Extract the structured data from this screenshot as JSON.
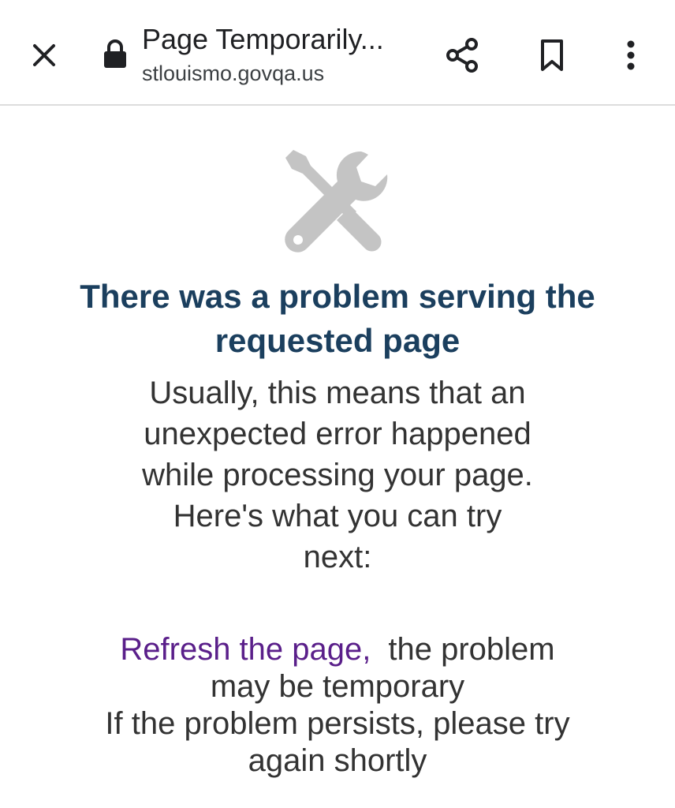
{
  "browser": {
    "page_title": "Page Temporarily...",
    "url": "stlouismo.govqa.us",
    "icons": {
      "close": "close-icon",
      "lock": "lock-icon",
      "share": "share-icon",
      "bookmark": "bookmark-icon",
      "menu": "more-vert-icon"
    }
  },
  "error": {
    "icon": "wrench-screwdriver-icon",
    "heading": "There was a problem serving the requested page",
    "body": "Usually, this means that an unexpected error happened while processing your page. Here's what you can try next:",
    "refresh_link": "Refresh the page,",
    "refresh_suffix": "the problem may be temporary",
    "persist_text": "If the problem persists, please try again shortly"
  },
  "colors": {
    "heading": "#1b3f5e",
    "link": "#5a1f8a",
    "body_text": "#333333",
    "icon_gray": "#c4c4c4",
    "toolbar_icon": "#202124"
  }
}
